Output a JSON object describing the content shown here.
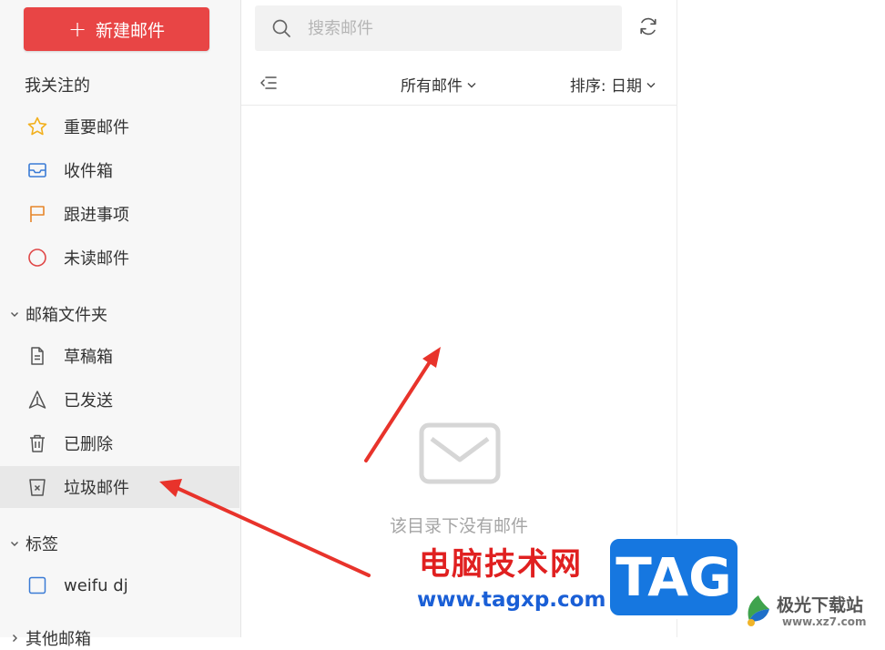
{
  "sidebar": {
    "compose_label": "新建邮件",
    "favorites_title": "我关注的",
    "favorites": [
      {
        "label": "重要邮件",
        "icon": "star-icon",
        "color": "#f2b01e"
      },
      {
        "label": "收件箱",
        "icon": "inbox-icon",
        "color": "#3a7bd5"
      },
      {
        "label": "跟进事项",
        "icon": "flag-icon",
        "color": "#e6862a"
      },
      {
        "label": "未读邮件",
        "icon": "circle-icon",
        "color": "#e04848"
      }
    ],
    "folders_title": "邮箱文件夹",
    "folders": [
      {
        "label": "草稿箱",
        "icon": "draft-icon"
      },
      {
        "label": "已发送",
        "icon": "sent-icon"
      },
      {
        "label": "已删除",
        "icon": "trash-icon"
      },
      {
        "label": "垃圾邮件",
        "icon": "spam-icon",
        "active": true
      }
    ],
    "tags_title": "标签",
    "tags": [
      {
        "label": "weifu dj",
        "icon": "tag-square-icon"
      }
    ],
    "other_title": "其他邮箱"
  },
  "list": {
    "search_placeholder": "搜索邮件",
    "filter_label": "所有邮件",
    "sort_label": "排序: 日期",
    "empty_text": "该目录下没有邮件"
  },
  "watermark": {
    "site_text": "电脑技术网",
    "site_url": "www.tagxp.com",
    "logo_text": "TAG",
    "brand_name": "极光下载站",
    "brand_url": "www.xz7.com"
  },
  "colors": {
    "accent": "#e84545",
    "annotation_arrow": "#e8332b"
  }
}
